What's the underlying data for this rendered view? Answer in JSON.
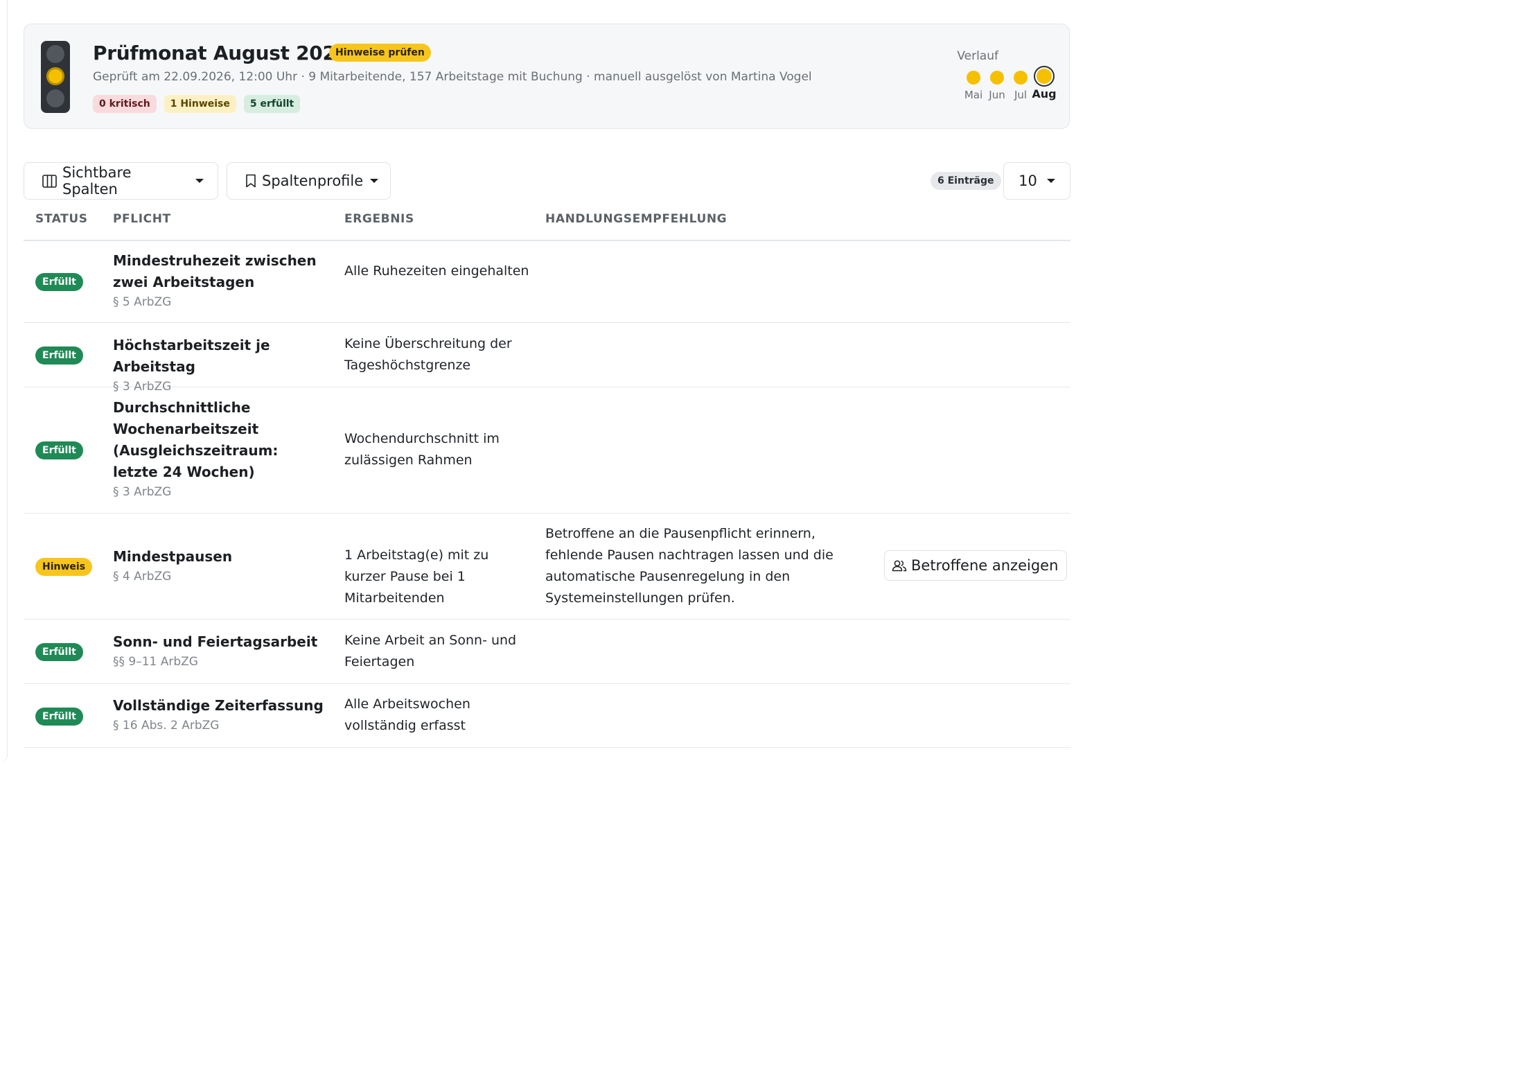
{
  "header": {
    "title": "Prüfmonat August 2026",
    "badge": "Hinweise prüfen",
    "meta": "Geprüft am 22.09.2026, 12:00 Uhr · 9 Mitarbeitende, 157 Arbeitstage mit Buchung · manuell ausgelöst von Martina Vogel",
    "summary": {
      "critical": "0 kritisch",
      "hints": "1 Hinweise",
      "passed": "5 erfüllt"
    },
    "traffic_light_state": "yellow",
    "history_label": "Verlauf",
    "history": [
      {
        "month": "Mai",
        "state": "yellow"
      },
      {
        "month": "Jun",
        "state": "yellow"
      },
      {
        "month": "Jul",
        "state": "yellow"
      },
      {
        "month": "Aug",
        "state": "yellow",
        "current": true
      }
    ]
  },
  "toolbar": {
    "columns_label": "Sichtbare Spalten",
    "profiles_label": "Spaltenprofile",
    "entries_badge": "6 Einträge",
    "page_size": "10"
  },
  "table": {
    "headers": {
      "status": "STATUS",
      "duty": "PFLICHT",
      "result": "ERGEBNIS",
      "advice": "HANDLUNGSEMPFEHLUNG"
    },
    "rows": [
      {
        "status": "Erfüllt",
        "title": "Mindestruhezeit zwischen zwei Arbeitstagen",
        "law": "§ 5 ArbZG",
        "result": "Alle Ruhezeiten eingehalten",
        "advice": "",
        "action": ""
      },
      {
        "status": "Erfüllt",
        "title": "Höchstarbeitszeit je Arbeitstag",
        "law": "§ 3 ArbZG",
        "result": "Keine Überschreitung der Tageshöchstgrenze",
        "advice": "",
        "action": ""
      },
      {
        "status": "Erfüllt",
        "title": "Durchschnittliche Wochenarbeitszeit (Ausgleichszeitraum: letzte 24 Wochen)",
        "law": "§ 3 ArbZG",
        "result": "Wochendurchschnitt im zulässigen Rahmen",
        "advice": "",
        "action": ""
      },
      {
        "status": "Hinweis",
        "title": "Mindestpausen",
        "law": "§ 4 ArbZG",
        "result": "1 Arbeitstag(e) mit zu kurzer Pause bei 1 Mitarbeitenden",
        "advice": "Betroffene an die Pausenpflicht erinnern, fehlende Pausen nachtragen lassen und die automatische Pausenregelung in den Systemeinstellungen prüfen.",
        "action": "Betroffene anzeigen"
      },
      {
        "status": "Erfüllt",
        "title": "Sonn- und Feiertagsarbeit",
        "law": "§§ 9–11 ArbZG",
        "result": "Keine Arbeit an Sonn- und Feiertagen",
        "advice": "",
        "action": ""
      },
      {
        "status": "Erfüllt",
        "title": "Vollständige Zeiterfassung",
        "law": "§ 16 Abs. 2 ArbZG",
        "result": "Alle Arbeitswochen vollständig erfasst",
        "advice": "",
        "action": ""
      }
    ]
  },
  "colors": {
    "ok": "#1f8a55",
    "hint": "#f7c51e",
    "critical_bg": "#f9dadd",
    "hint_bg": "#fdf1c4",
    "ok_bg": "#d6ede0"
  },
  "icons": {
    "columns_button": "columns-icon",
    "profiles_button": "bookmark-icon",
    "action_button": "users-icon"
  }
}
